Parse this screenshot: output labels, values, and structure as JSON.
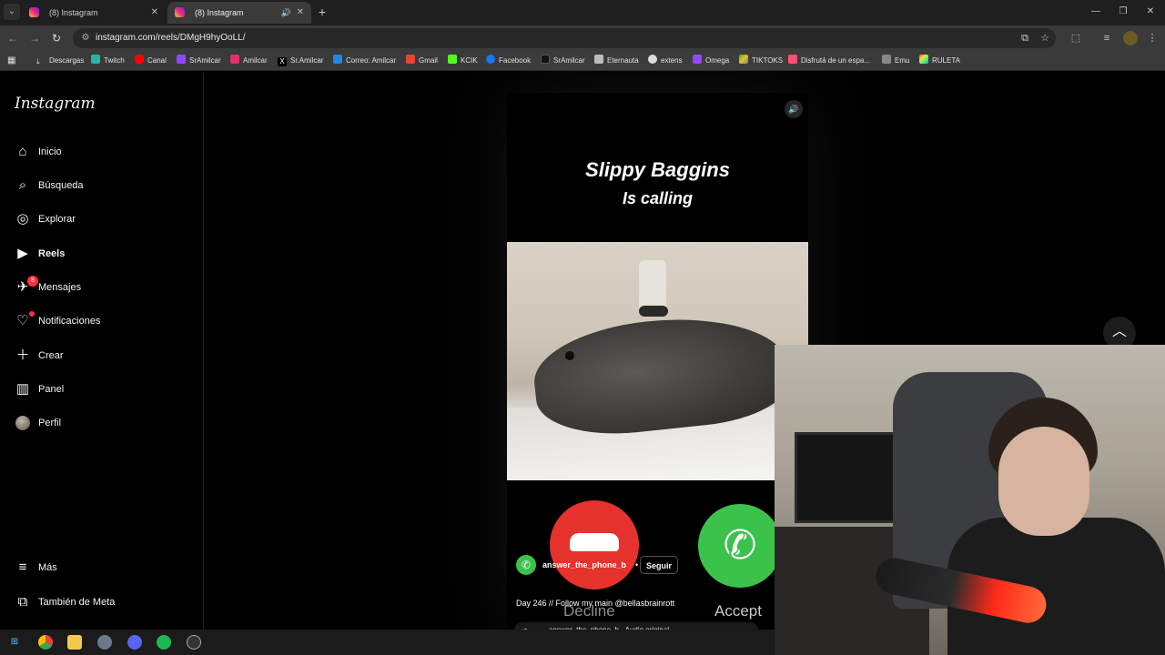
{
  "browser": {
    "tabs": [
      {
        "title": "(8) Instagram"
      },
      {
        "title": "(8) Instagram"
      }
    ],
    "url": "instagram.com/reels/DMgH9hyOoLL/",
    "bookmarks": [
      {
        "label": "Descargas"
      },
      {
        "label": "Twitch"
      },
      {
        "label": "Canal"
      },
      {
        "label": "SrAmilcar"
      },
      {
        "label": "Amilcar"
      },
      {
        "label": "Sr.Amilcar"
      },
      {
        "label": "Correo: Amilcar"
      },
      {
        "label": "Gmail"
      },
      {
        "label": "KCIK"
      },
      {
        "label": "Facebook"
      },
      {
        "label": "SrAmilcar"
      },
      {
        "label": "Eternauta"
      },
      {
        "label": "extens"
      },
      {
        "label": "Omega"
      },
      {
        "label": "TIKTOKS"
      },
      {
        "label": "Disfrutá de un espa..."
      },
      {
        "label": "Emu"
      },
      {
        "label": "RULETA"
      }
    ]
  },
  "instagram": {
    "logo": "Instagram",
    "nav": [
      {
        "label": "Inicio",
        "icon": "home-icon"
      },
      {
        "label": "Búsqueda",
        "icon": "search-icon"
      },
      {
        "label": "Explorar",
        "icon": "compass-icon"
      },
      {
        "label": "Reels",
        "icon": "reels-icon",
        "active": true
      },
      {
        "label": "Mensajes",
        "icon": "messenger-icon",
        "badge": "8"
      },
      {
        "label": "Notificaciones",
        "icon": "heart-icon"
      },
      {
        "label": "Crear",
        "icon": "plus-icon"
      },
      {
        "label": "Panel",
        "icon": "chart-icon"
      },
      {
        "label": "Perfil",
        "icon": "avatar"
      }
    ],
    "more": "Más",
    "meta": "También de Meta"
  },
  "reel": {
    "caller_name": "Slippy Baggins",
    "calling_text": "Is calling",
    "decline_label": "Decline",
    "accept_label": "Accept",
    "username": "answer_the_phone_b",
    "separator": "•",
    "follow_label": "Seguir",
    "caption": "Day 246 // Follow my main @bellasbrainrott",
    "audio": "answer_the_phone_b · Audio original"
  }
}
